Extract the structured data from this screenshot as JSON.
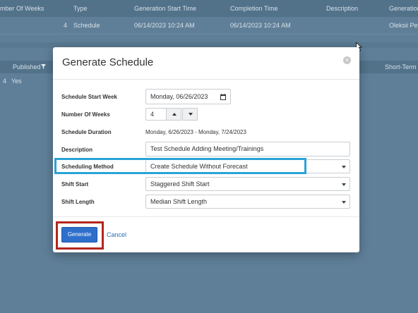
{
  "background": {
    "header": [
      "mber Of Weeks",
      "Type",
      "Generation Start Time",
      "Completion Time",
      "Description",
      "Generation"
    ],
    "row": {
      "weeks": "4",
      "type": "Schedule",
      "start": "06/14/2023 10:24 AM",
      "completion": "06/14/2023 10:24 AM",
      "user": "Oleksii Petr"
    },
    "header2": {
      "published": "Published",
      "short_term": "Short-Term F"
    },
    "row2": {
      "num": "4",
      "published": "Yes"
    }
  },
  "modal": {
    "title": "Generate Schedule",
    "close_glyph": "×",
    "fields": {
      "start_week": {
        "label": "Schedule Start Week",
        "value": "Monday, 06/26/2023"
      },
      "num_weeks": {
        "label": "Number Of Weeks",
        "value": "4"
      },
      "duration": {
        "label": "Schedule Duration",
        "value": "Monday, 6/26/2023 - Monday, 7/24/2023"
      },
      "description": {
        "label": "Description",
        "value": "Test Schedule Adding Meeting/Trainings"
      },
      "method": {
        "label": "Scheduling Method",
        "value": "Create Schedule Without Forecast"
      },
      "shift_start": {
        "label": "Shift Start",
        "value": "Staggered Shift Start"
      },
      "shift_length": {
        "label": "Shift Length",
        "value": "Median Shift Length"
      }
    },
    "generate_label": "Generate",
    "cancel_label": "Cancel"
  },
  "colors": {
    "accent_blue": "#29a3d6",
    "accent_red": "#b5261c",
    "primary_button": "#2e6fcc"
  }
}
